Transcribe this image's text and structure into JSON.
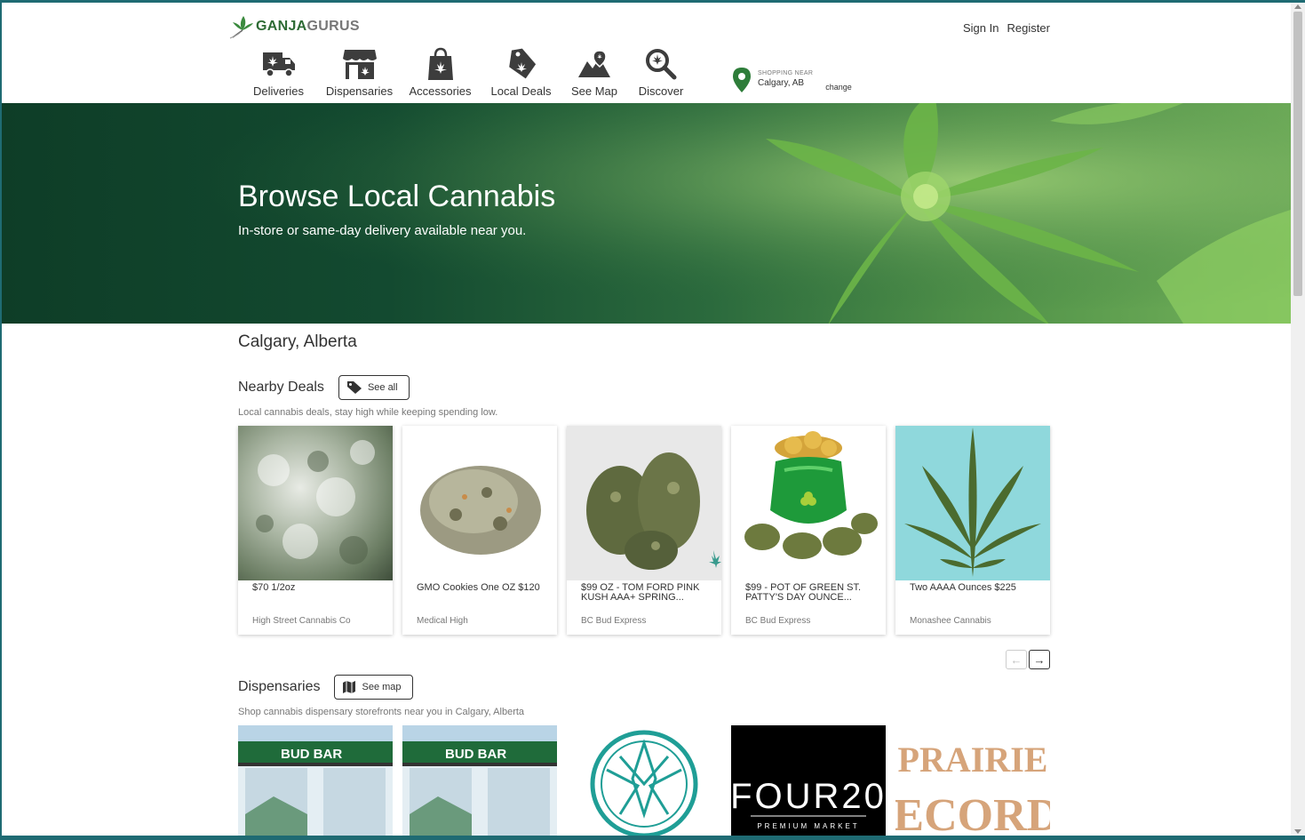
{
  "header": {
    "logo_text_a": "GANJA",
    "logo_text_b": "GURUS",
    "sign_in": "Sign In",
    "register": "Register"
  },
  "nav": {
    "items": [
      {
        "label": "Deliveries",
        "icon": "delivery-truck-icon"
      },
      {
        "label": "Dispensaries",
        "icon": "storefront-icon"
      },
      {
        "label": "Accessories",
        "icon": "shopping-bag-icon"
      },
      {
        "label": "Local Deals",
        "icon": "price-tag-icon"
      },
      {
        "label": "See Map",
        "icon": "map-icon"
      },
      {
        "label": "Discover",
        "icon": "magnifier-icon"
      }
    ]
  },
  "shopping": {
    "label": "SHOPPING NEAR",
    "city": "Calgary, AB",
    "change": "change"
  },
  "hero": {
    "title": "Browse Local Cannabis",
    "subtitle": "In-store or same-day delivery available near you."
  },
  "location_title": "Calgary, Alberta",
  "deals": {
    "heading": "Nearby Deals",
    "button": "See all",
    "description": "Local cannabis deals, stay high while keeping spending low.",
    "items": [
      {
        "title": "$70 1/2oz",
        "store": "High Street Cannabis Co"
      },
      {
        "title": "GMO Cookies One OZ $120",
        "store": "Medical High"
      },
      {
        "title": "$99 OZ - TOM FORD PINK KUSH AAA+ SPRING...",
        "store": "BC Bud Express"
      },
      {
        "title": "$99 - POT OF GREEN ST. PATTY'S DAY OUNCE...",
        "store": "BC Bud Express"
      },
      {
        "title": "Two AAAA Ounces $225",
        "store": "Monashee Cannabis"
      }
    ]
  },
  "dispensaries": {
    "heading": "Dispensaries",
    "button": "See map",
    "description": "Shop cannabis dispensary storefronts near you in Calgary, Alberta",
    "items": [
      {
        "sign": "BUD BAR"
      },
      {
        "sign": "BUD BAR"
      },
      {
        "sign": ""
      },
      {
        "sign": "FOUR20",
        "sub": "PREMIUM MARKET"
      },
      {
        "sign": "PRAIRIE",
        "sign2": "RECORDS"
      }
    ]
  },
  "colors": {
    "brand_green": "#2e6b35",
    "hero_dark": "#0e3d27",
    "teal": "#1f9e96",
    "deal_bg_blue": "#8fd8dc"
  }
}
